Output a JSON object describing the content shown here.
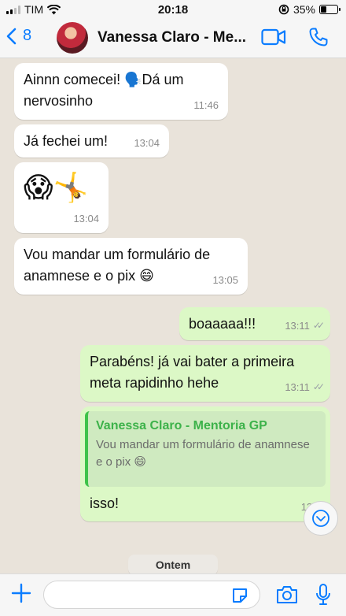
{
  "status_bar": {
    "carrier": "TIM",
    "time": "20:18",
    "battery": "35%",
    "battery_level": 0.35,
    "icons": [
      "signal-icon",
      "wifi-icon",
      "orientation-lock-icon",
      "battery-icon"
    ]
  },
  "header": {
    "back_count": "8",
    "contact_name": "Vanessa Claro - Me...",
    "icons": [
      "back-chevron-icon",
      "avatar",
      "video-call-icon",
      "phone-icon"
    ]
  },
  "messages": [
    {
      "dir": "in",
      "text": "Ainnn comecei! 🗣️Dá um nervosinho",
      "time": "11:46"
    },
    {
      "dir": "in",
      "text": "Já fechei um!",
      "time": "13:04"
    },
    {
      "dir": "in",
      "text": "😱🤸",
      "time": "13:04"
    },
    {
      "dir": "in",
      "text": "Vou mandar um formulário de anamnese e o pix 😄",
      "time": "13:05"
    },
    {
      "dir": "out",
      "text": "boaaaaa!!!",
      "time": "13:11",
      "status": "read"
    },
    {
      "dir": "out",
      "text": "Parabéns! já vai bater a primeira meta rapidinho hehe",
      "time": "13:11",
      "status": "read"
    },
    {
      "dir": "out",
      "reply_to": {
        "name": "Vanessa Claro - Mentoria GP",
        "text": "Vou mandar um formulário de anamnese e o pix 😄"
      },
      "text": "isso!",
      "time": "13:1"
    }
  ],
  "ticks": "✓✓",
  "date_divider": "Ontem",
  "input": {
    "value": "",
    "placeholder": ""
  },
  "colors": {
    "accent": "#0a7cff",
    "incoming_bubble": "#ffffff",
    "outgoing_bubble": "#dcf8c6",
    "quote_name": "#3db24a",
    "chat_background": "#e9e3da"
  }
}
